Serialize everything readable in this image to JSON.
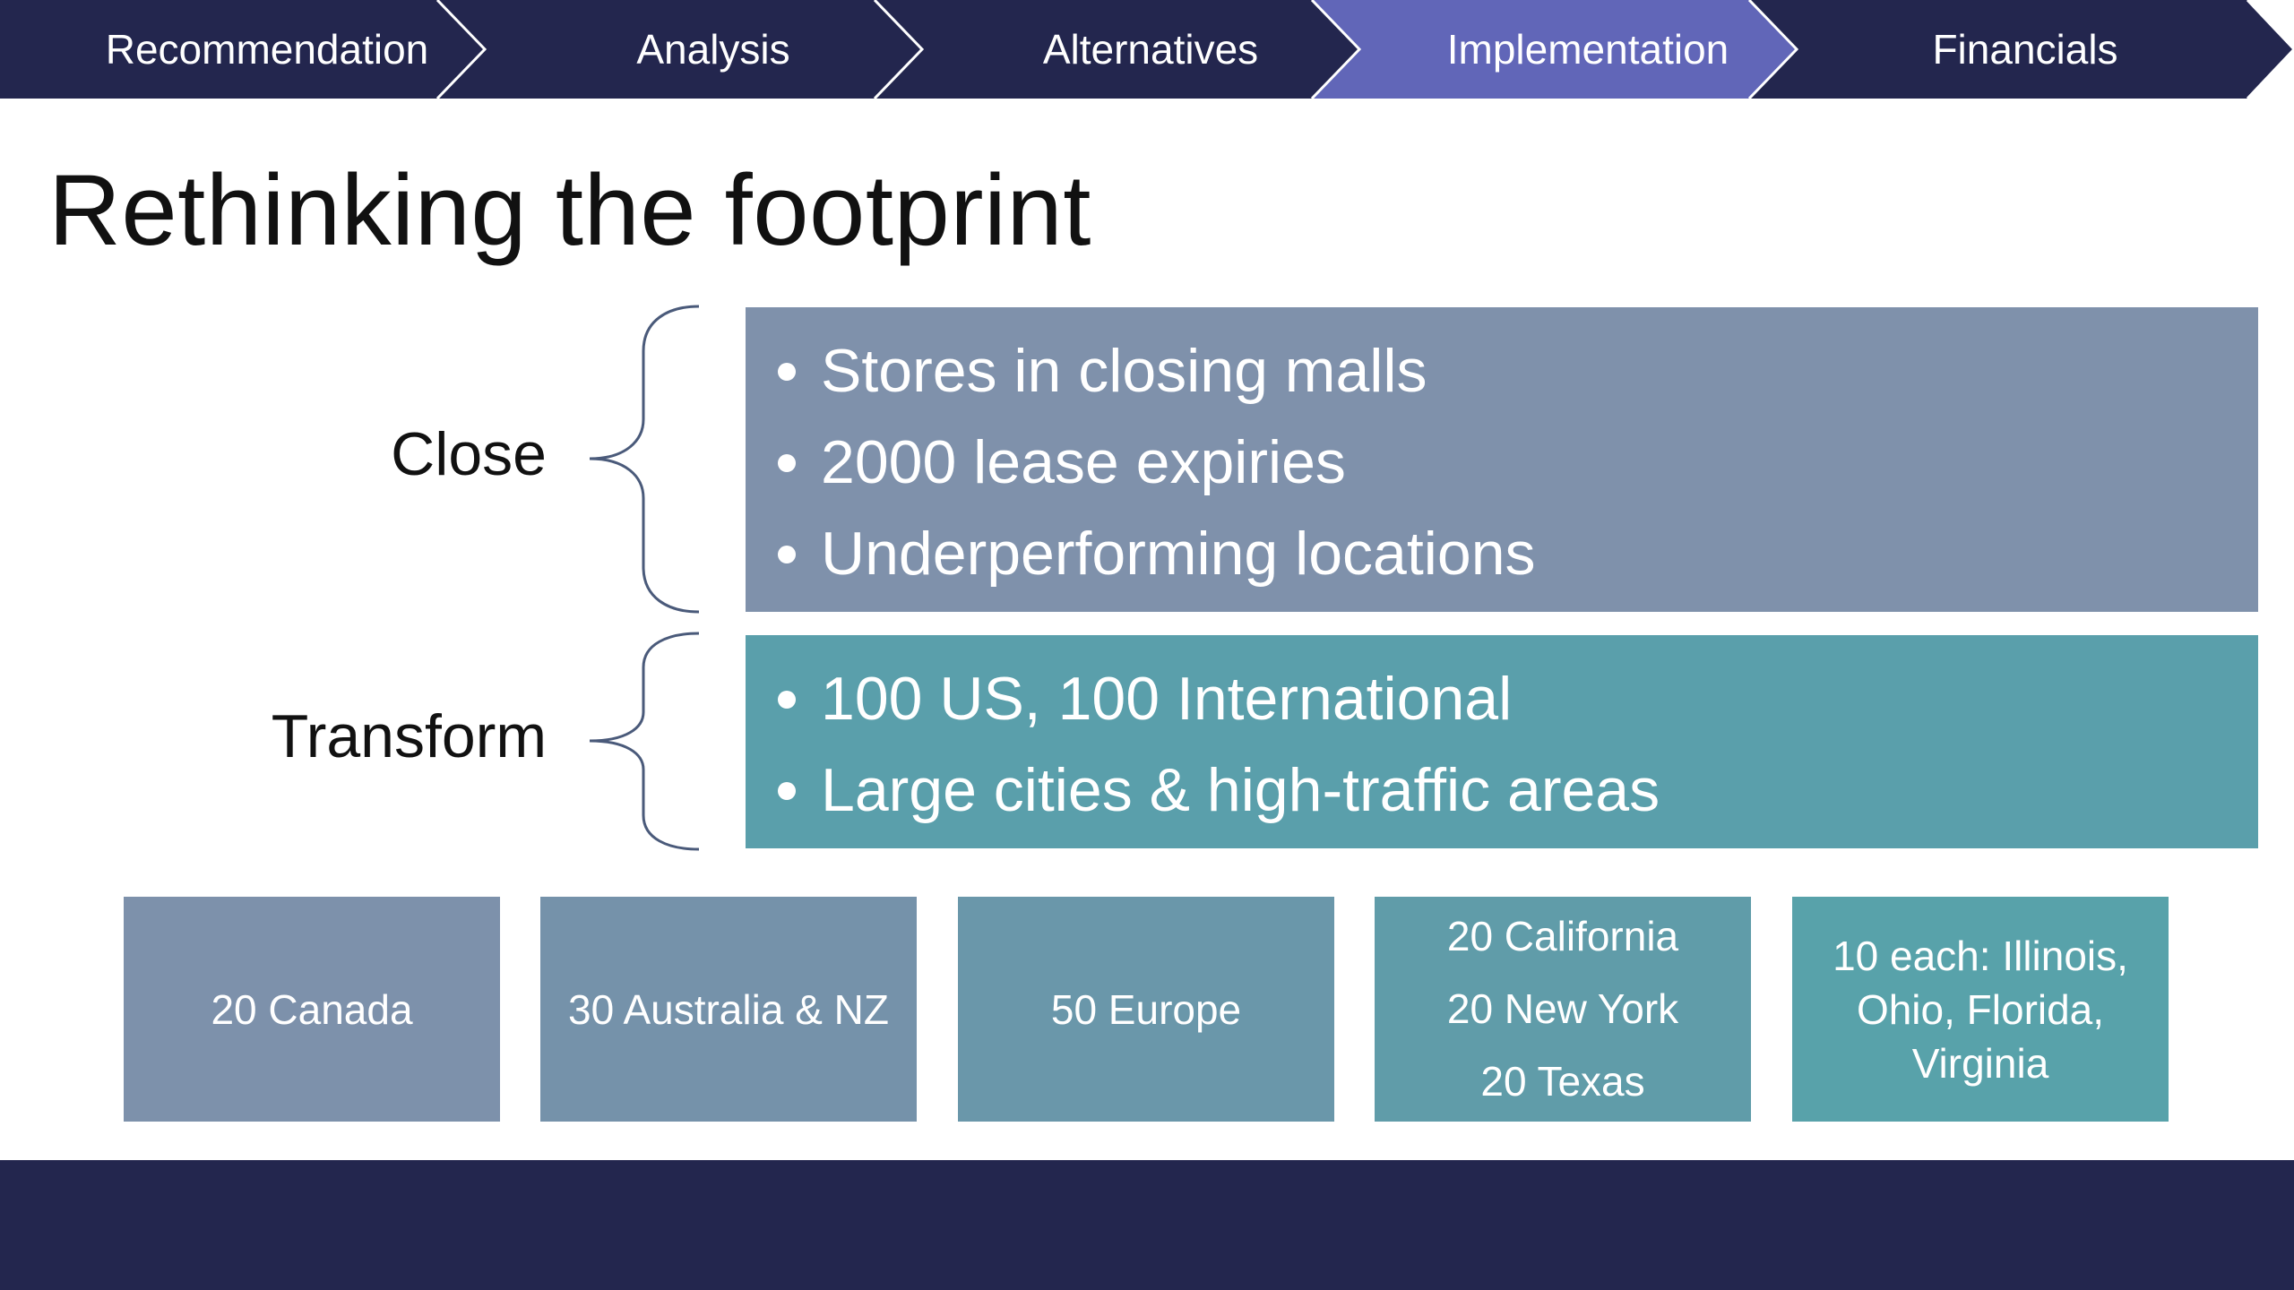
{
  "nav": {
    "tabs": [
      {
        "label": "Recommendation",
        "active": false
      },
      {
        "label": "Analysis",
        "active": false
      },
      {
        "label": "Alternatives",
        "active": false
      },
      {
        "label": "Implementation",
        "active": true
      },
      {
        "label": "Financials",
        "active": false
      }
    ]
  },
  "slide": {
    "title": "Rethinking the footprint"
  },
  "groups": {
    "close": {
      "label": "Close",
      "items": [
        "Stores in closing malls",
        "2000 lease expiries",
        "Underperforming locations"
      ]
    },
    "transform": {
      "label": "Transform",
      "items": [
        "100 US, 100 International",
        "Large cities & high-traffic areas"
      ]
    }
  },
  "tiles": [
    {
      "lines": [
        "20 Canada"
      ]
    },
    {
      "lines": [
        "30 Australia & NZ"
      ]
    },
    {
      "lines": [
        "50 Europe"
      ]
    },
    {
      "lines": [
        "20 California",
        "20 New York",
        "20 Texas"
      ]
    },
    {
      "lines": [
        "10 each: Illinois,",
        "Ohio, Florida,",
        "Virginia"
      ]
    }
  ],
  "colors": {
    "nav_dark": "#23264e",
    "nav_active": "#6166b8",
    "close_panel": "#7f91ab",
    "transform_panel": "#5a9fab",
    "tile_1": "#7d91ab",
    "tile_2": "#7592aa",
    "tile_3": "#6a97aa",
    "tile_4": "#609ca9",
    "tile_5": "#58a2aa",
    "footer": "#23264e"
  }
}
